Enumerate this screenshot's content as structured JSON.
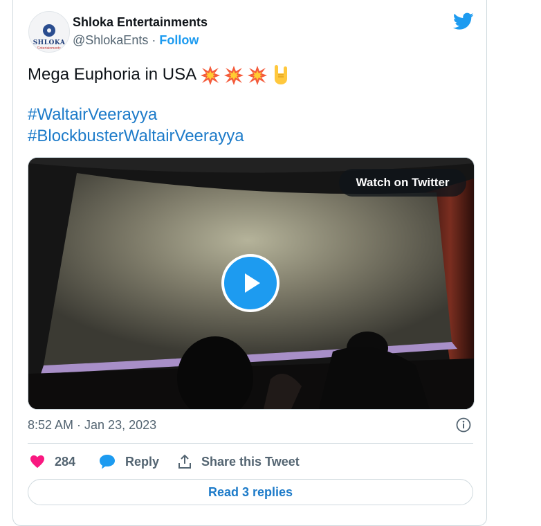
{
  "author": {
    "name": "Shloka Entertainments",
    "handle": "@ShlokaEnts",
    "separator": "·",
    "follow_label": "Follow",
    "avatar_text": "SHLOKA",
    "avatar_subtext": "Entertainments"
  },
  "tweet": {
    "text": "Mega Euphoria in USA",
    "emojis": [
      "collision-icon",
      "collision-icon",
      "collision-icon",
      "sign-of-horns-icon"
    ],
    "hashtags": [
      "#WaltairVeerayya",
      "#BlockbusterWaltairVeerayya"
    ]
  },
  "media": {
    "watch_label": "Watch on Twitter"
  },
  "meta": {
    "timestamp": "8:52 AM · Jan 23, 2023"
  },
  "actions": {
    "like_count": "284",
    "reply_label": "Reply",
    "share_label": "Share this Tweet"
  },
  "read_replies_label": "Read 3 replies",
  "colors": {
    "accent": "#1d9bf0",
    "link": "#1d7bc9",
    "like": "#f91880",
    "text": "#0f1419",
    "secondary": "#536471",
    "border": "#cfd9de"
  }
}
